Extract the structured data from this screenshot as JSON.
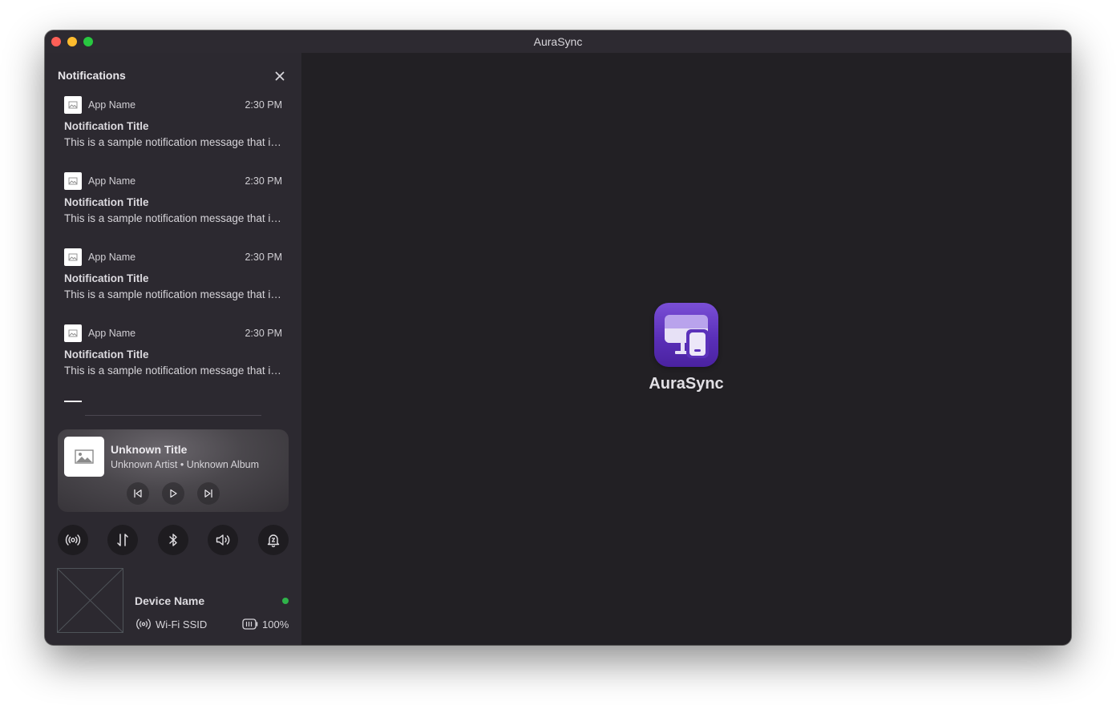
{
  "window": {
    "title": "AuraSync"
  },
  "notifications": {
    "header": "Notifications",
    "items": [
      {
        "app_name": "App Name",
        "time": "2:30 PM",
        "title": "Notification Title",
        "message": "This is a sample notification message that is quite long"
      },
      {
        "app_name": "App Name",
        "time": "2:30 PM",
        "title": "Notification Title",
        "message": "This is a sample notification message that is quite long"
      },
      {
        "app_name": "App Name",
        "time": "2:30 PM",
        "title": "Notification Title",
        "message": "This is a sample notification message that is quite long"
      },
      {
        "app_name": "App Name",
        "time": "2:30 PM",
        "title": "Notification Title",
        "message": "This is a sample notification message that is quite long"
      }
    ]
  },
  "media": {
    "title": "Unknown Title",
    "subtitle": "Unknown Artist • Unknown Album"
  },
  "quick_actions": [
    "broadcast-icon",
    "swap-icon",
    "bluetooth-icon",
    "speaker-icon",
    "notification-bell-icon"
  ],
  "device": {
    "name": "Device Name",
    "status_color": "#2fb34a",
    "wifi": "Wi-Fi SSID",
    "battery": "100%"
  },
  "main": {
    "app_label": "AuraSync",
    "logo_gradient": [
      "#7a4fd6",
      "#4a22a0"
    ]
  }
}
